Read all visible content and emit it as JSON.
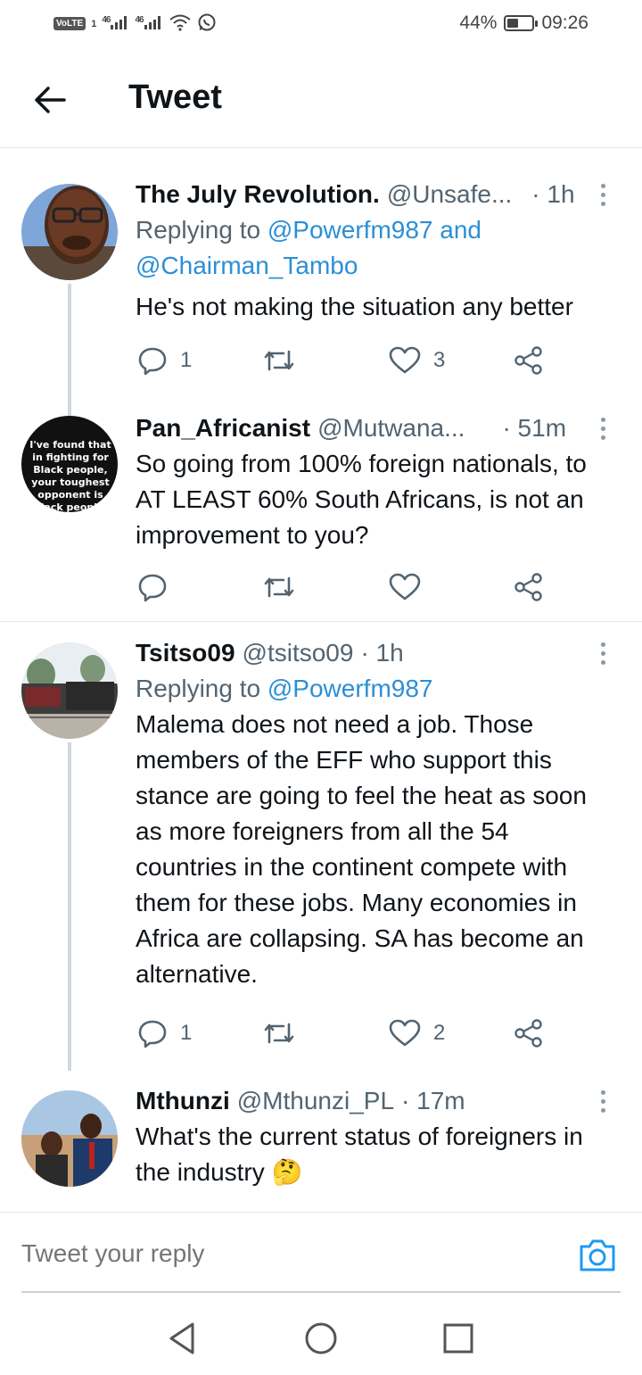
{
  "status_bar": {
    "volte": "VoLTE",
    "sim1": "1",
    "net1": "46",
    "net2": "46",
    "battery_percent": "44%",
    "battery_level": 0.44,
    "time": "09:26"
  },
  "header": {
    "back_icon": "back-arrow-icon",
    "title": "Tweet"
  },
  "tweets": [
    {
      "name": "The July Revolution.",
      "handle": "@Unsafe...",
      "time": "· 1h",
      "replying_prefix": "Replying to ",
      "replying_mentions": "@Powerfm987 and",
      "replying_mentions2": "@Chairman_Tambo",
      "text": "He's not making the situation any better",
      "reply_count": "1",
      "retweet_count": "",
      "like_count": "3"
    },
    {
      "name": "Pan_Africanist",
      "handle": "@Mutwana...",
      "time": "· 51m",
      "avatar_text": "I've found that in fighting for Black people, your toughest opponent is Black people.",
      "text_lines": [
        "So going from 100% foreign nationals, to",
        "AT LEAST 60% South Africans, is not an",
        "improvement to you?"
      ],
      "reply_count": "",
      "retweet_count": "",
      "like_count": ""
    },
    {
      "name": "Tsitso09",
      "handle": "@tsitso09",
      "time": "· 1h",
      "replying_prefix": "Replying to ",
      "replying_mentions": "@Powerfm987",
      "text_lines": [
        "Malema does not need a job. Those",
        "members of the EFF who support this",
        "stance are going to feel the heat as soon",
        "as more foreigners from all the 54",
        "countries in the continent compete with",
        "them for these jobs. Many economies in",
        "Africa are collapsing. SA has become an",
        "alternative."
      ],
      "reply_count": "1",
      "retweet_count": "",
      "like_count": "2"
    },
    {
      "name": "Mthunzi",
      "handle": "@Mthunzi_PL",
      "time": "· 17m",
      "text_lines": [
        "What's the current status of foreigners in",
        "the industry 🤔"
      ]
    }
  ],
  "reply_bar": {
    "placeholder": "Tweet your reply",
    "camera_icon": "camera-icon"
  },
  "colors": {
    "accent": "#1d9bf0",
    "muted": "#536471",
    "text": "#0f1419"
  }
}
